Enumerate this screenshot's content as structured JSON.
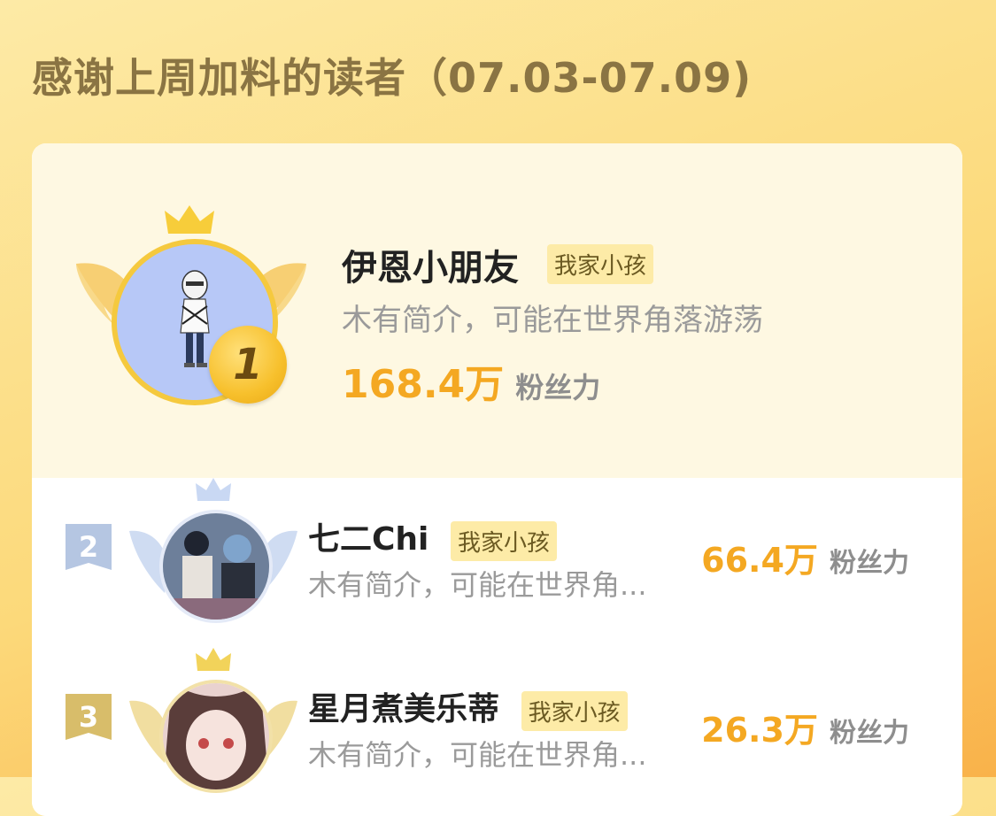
{
  "header": {
    "title": "感谢上周加料的读者（07.03-07.09)"
  },
  "top_reader": {
    "rank": "1",
    "name": "伊恩小朋友",
    "tag": "我家小孩",
    "bio": "木有简介，可能在世界角落游荡",
    "score": "168.4万",
    "score_label": "粉丝力"
  },
  "readers": [
    {
      "rank": "2",
      "name": "七二Chi",
      "tag": "我家小孩",
      "bio": "木有简介，可能在世界角...",
      "score": "66.4万",
      "score_label": "粉丝力"
    },
    {
      "rank": "3",
      "name": "星月煮美乐蒂",
      "tag": "我家小孩",
      "bio": "木有简介，可能在世界角...",
      "score": "26.3万",
      "score_label": "粉丝力"
    }
  ],
  "colors": {
    "gold": "#f4a822",
    "silver": "#b5c6e2",
    "bronze": "#d8bd6a",
    "tag_bg": "#fdeba7"
  },
  "icons": [
    "crown-icon",
    "wings-icon",
    "rank-medal-icon",
    "rank-ribbon-icon"
  ]
}
